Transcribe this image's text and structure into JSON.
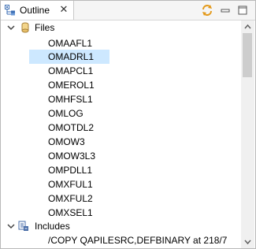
{
  "tab": {
    "label": "Outline",
    "icon": "outline-icon",
    "close": "✕"
  },
  "toolbar": {
    "sync_icon": "sync-icon",
    "minimize_icon": "minimize-icon",
    "maximize_icon": "maximize-icon"
  },
  "tree": {
    "files": {
      "label": "Files",
      "icon": "files-icon",
      "items": [
        "OMAAFL1",
        "OMADRL1",
        "OMAPCL1",
        "OMEROL1",
        "OMHFSL1",
        "OMLOG",
        "OMOTDL2",
        "OMOW3",
        "OMOW3L3",
        "OMPDLL1",
        "OMXFUL1",
        "OMXFUL2",
        "OMXSEL1"
      ],
      "selected_index": 1
    },
    "includes": {
      "label": "Includes",
      "icon": "includes-icon",
      "items": [
        "/COPY QAPILESRC,DEFBINARY at 218/7"
      ]
    }
  },
  "colors": {
    "selection": "#cde8ff",
    "accent": "#e39a1c"
  }
}
